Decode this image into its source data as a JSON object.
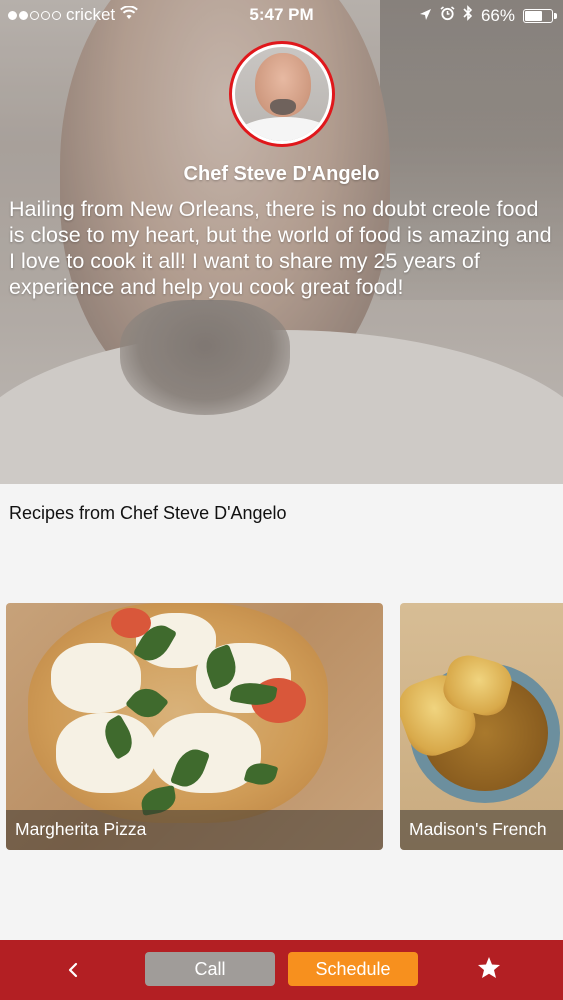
{
  "status_bar": {
    "carrier": "cricket",
    "time": "5:47 PM",
    "battery": "66%",
    "battery_level": 0.66,
    "signal_dots_filled": 2,
    "signal_dots_total": 5,
    "icons": [
      "wifi-icon",
      "location-arrow-icon",
      "alarm-icon",
      "bluetooth-icon",
      "battery-icon"
    ]
  },
  "profile": {
    "name": "Chef Steve D'Angelo",
    "bio": "Hailing from New Orleans, there is no doubt creole food is close to my heart, but the world of food is amazing and I love to cook it all! I want to share my 25 years of experience and help you cook great food!",
    "avatar_border_color": "#e0171b"
  },
  "recipes": {
    "title": "Recipes from Chef Steve D'Angelo",
    "items": [
      {
        "name": "Margherita Pizza"
      },
      {
        "name": "Madison's French"
      }
    ]
  },
  "tab_bar": {
    "background": "#b31f23",
    "back_icon": "chevron-left-icon",
    "call_label": "Call",
    "schedule_label": "Schedule",
    "star_icon": "star-icon",
    "call_color": "#a09c99",
    "schedule_color": "#f7901e"
  }
}
